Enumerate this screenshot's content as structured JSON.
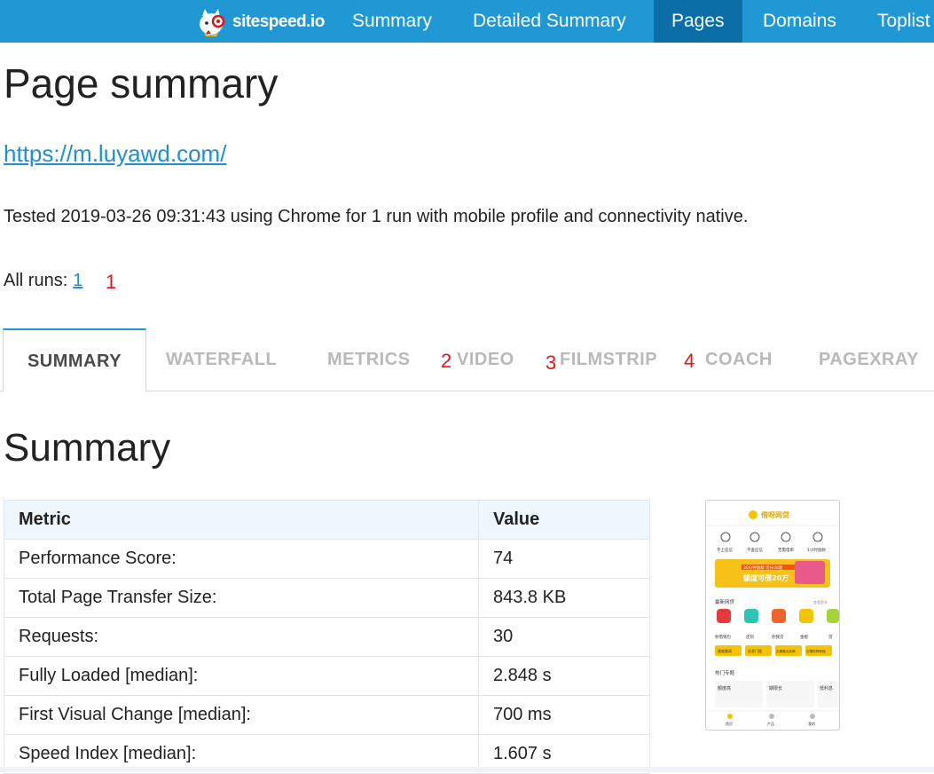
{
  "nav": {
    "brand": "sitespeed.io",
    "items": [
      {
        "label": "Summary"
      },
      {
        "label": "Detailed Summary"
      },
      {
        "label": "Pages"
      },
      {
        "label": "Domains"
      },
      {
        "label": "Toplist"
      }
    ],
    "active": "Pages",
    "color": "#1f98d3",
    "active_color": "#0c6ea6"
  },
  "page": {
    "title": "Page summary",
    "url": "https://m.luyawd.com/",
    "tested_text": "Tested 2019-03-26 09:31:43 using Chrome for 1 run with mobile profile and connectivity native.",
    "all_runs_label": "All runs:",
    "runs": [
      "1"
    ]
  },
  "annotations": [
    "1",
    "2",
    "3",
    "4"
  ],
  "tabs": [
    {
      "label": "SUMMARY"
    },
    {
      "label": "WATERFALL"
    },
    {
      "label": "METRICS"
    },
    {
      "label": "VIDEO"
    },
    {
      "label": "FILMSTRIP"
    },
    {
      "label": "COACH"
    },
    {
      "label": "PAGEXRAY"
    }
  ],
  "active_tab": "SUMMARY",
  "summary": {
    "title": "Summary",
    "headers": [
      "Metric",
      "Value"
    ],
    "rows": [
      {
        "metric": "Performance Score:",
        "value": "74"
      },
      {
        "metric": "Total Page Transfer Size:",
        "value": "843.8 KB"
      },
      {
        "metric": "Requests:",
        "value": "30"
      },
      {
        "metric": "Fully Loaded [median]:",
        "value": "2.848 s"
      },
      {
        "metric": "First Visual Change [median]:",
        "value": "700 ms"
      },
      {
        "metric": "Speed Index [median]:",
        "value": "1.607 s"
      }
    ]
  },
  "thumbnail": {
    "app_name": "借呀网贷",
    "icons": [
      "不上征信",
      "不查征信",
      "无需电审",
      "1小时放款"
    ],
    "banner_line1": "30分钟放款 可分36期",
    "banner_line2": "额度可借20万",
    "section1": "最新网贷",
    "section1_more": "查看更多",
    "products": [
      "秒借钱包",
      "还呗",
      "你我贷",
      "金橙",
      "贷"
    ],
    "tags": [
      "额度最高",
      "低息门槛",
      "无需营业执照",
      "无需抵押担保"
    ],
    "section2": "热门专题",
    "topics": [
      "额度高",
      "期限长",
      "低利息"
    ],
    "bottom_nav": [
      "首页",
      "产品",
      "我的"
    ]
  }
}
